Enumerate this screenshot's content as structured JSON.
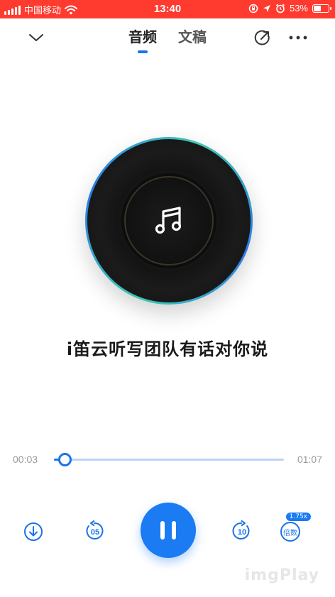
{
  "status_bar": {
    "carrier": "中国移动",
    "time": "13:40",
    "battery_percent_text": "53%",
    "battery_level": 0.53,
    "background_color": "#ff3b30"
  },
  "header": {
    "tabs": [
      {
        "label": "音频",
        "active": true
      },
      {
        "label": "文稿",
        "active": false
      }
    ],
    "collapse_icon": "chevron-down-icon",
    "share_icon": "share-arrow-icon",
    "more_icon": "more-dots-icon"
  },
  "player": {
    "title": "i笛云听写团队有话对你说",
    "disc_icon": "music-note-icon",
    "current_time": "00:03",
    "total_time": "01:07",
    "progress": 0.045,
    "accent_color": "#1a73e8"
  },
  "controls": {
    "download_icon": "download-icon",
    "rewind_label": "05",
    "forward_label": "10",
    "play_state": "playing",
    "speed_label": "倍数",
    "speed_value": "1.75x"
  },
  "watermark": "imgPlay"
}
